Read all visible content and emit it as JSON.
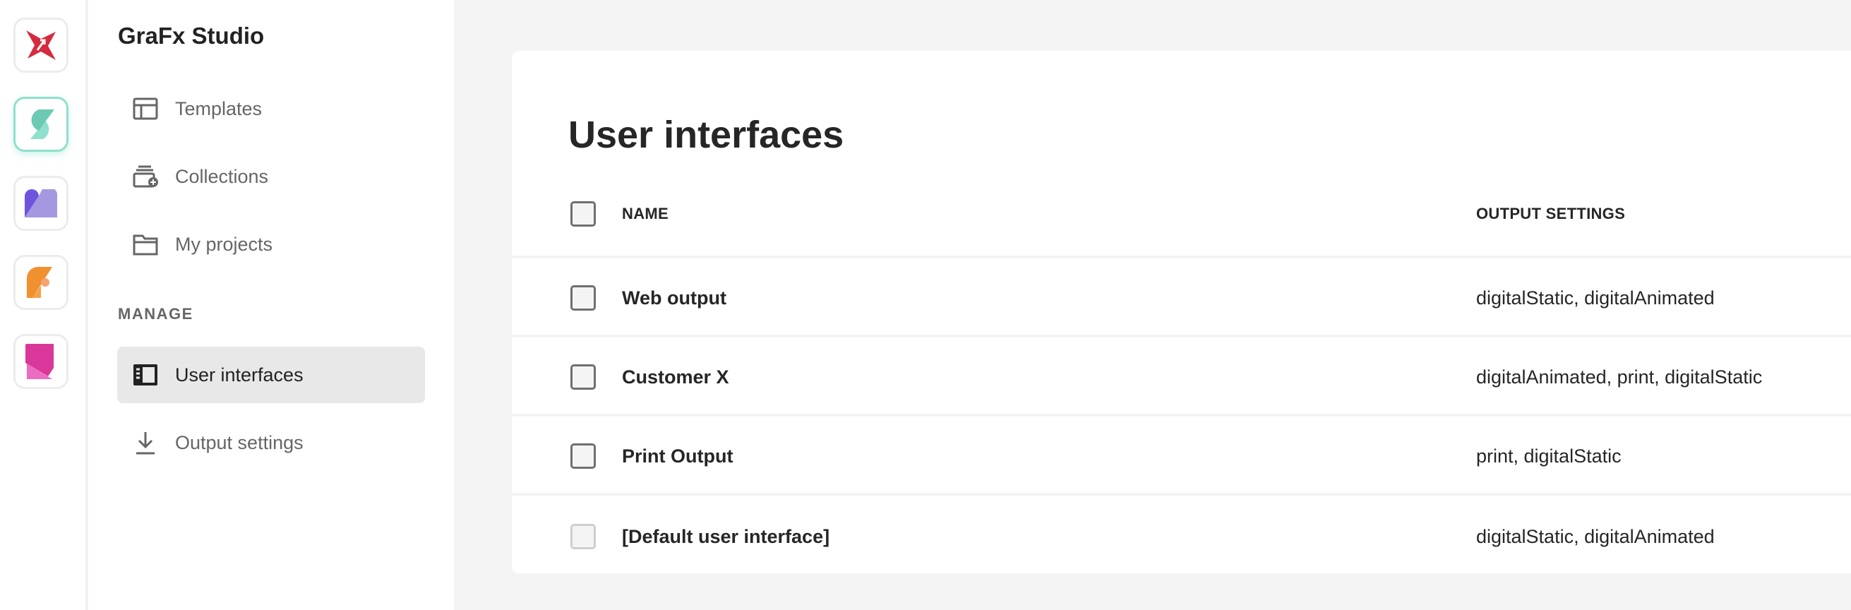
{
  "rail": {
    "apps": [
      {
        "name": "grafx-logo",
        "color": "#d62b3f"
      },
      {
        "name": "studio-app",
        "color": "#8fe0cc",
        "active": true
      },
      {
        "name": "purple-app",
        "color": "#7d63e0"
      },
      {
        "name": "orange-app",
        "color": "#f08a2a"
      },
      {
        "name": "pink-app",
        "color": "#d9379a"
      }
    ]
  },
  "sidebar": {
    "title": "GraFx Studio",
    "items": [
      {
        "label": "Templates",
        "icon": "template-icon"
      },
      {
        "label": "Collections",
        "icon": "collections-icon"
      },
      {
        "label": "My projects",
        "icon": "folder-icon"
      }
    ],
    "manage_heading": "MANAGE",
    "manage_items": [
      {
        "label": "User interfaces",
        "icon": "user-interface-icon",
        "selected": true
      },
      {
        "label": "Output settings",
        "icon": "download-icon"
      }
    ]
  },
  "main": {
    "title": "User interfaces",
    "columns": {
      "name": "NAME",
      "output": "OUTPUT SETTINGS"
    },
    "rows": [
      {
        "name": "Web output",
        "output": "digitalStatic, digitalAnimated"
      },
      {
        "name": "Customer X",
        "output": "digitalAnimated, print, digitalStatic"
      },
      {
        "name": "Print Output",
        "output": "print, digitalStatic"
      },
      {
        "name": "[Default user interface]",
        "output": "digitalStatic, digitalAnimated",
        "disabled": true
      }
    ]
  }
}
